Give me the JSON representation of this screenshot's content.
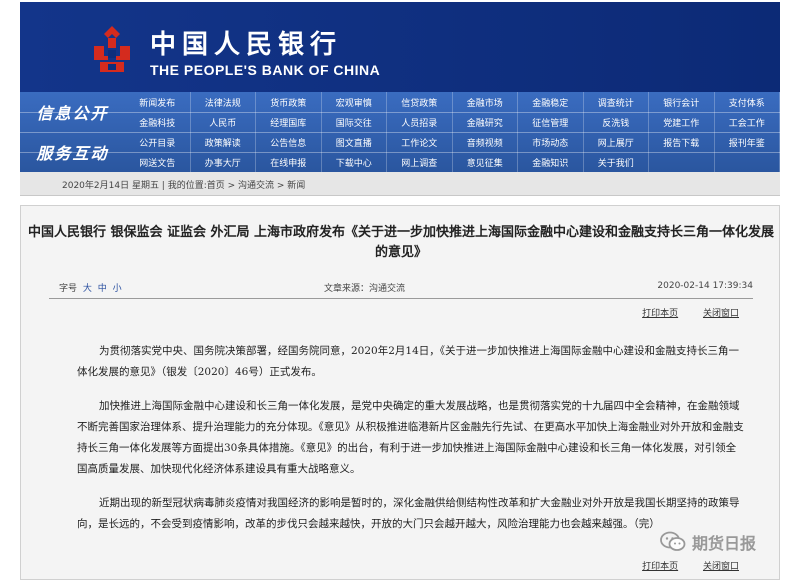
{
  "header": {
    "bank_name_cn": "中国人民银行",
    "bank_name_en": "THE PEOPLE'S BANK OF CHINA"
  },
  "nav": {
    "info_label": "信息公开",
    "service_label": "服务互动",
    "rows": [
      [
        "新闻发布",
        "法律法规",
        "货币政策",
        "宏观审慎",
        "信贷政策",
        "金融市场",
        "金融稳定",
        "调查统计",
        "银行会计",
        "支付体系"
      ],
      [
        "金融科技",
        "人民币",
        "经理国库",
        "国际交往",
        "人员招录",
        "金融研究",
        "征信管理",
        "反洗钱",
        "党建工作",
        "工会工作"
      ],
      [
        "公开目录",
        "政策解读",
        "公告信息",
        "图文直播",
        "工作论文",
        "音频视频",
        "市场动态",
        "网上展厅",
        "报告下载",
        "报刊年鉴"
      ],
      [
        "网送文告",
        "办事大厅",
        "在线申报",
        "下载中心",
        "网上调查",
        "意见征集",
        "金融知识",
        "关于我们",
        "",
        ""
      ]
    ]
  },
  "breadcrumb": "2020年2月14日 星期五 | 我的位置:首页 > 沟通交流 > 新闻",
  "article": {
    "title": "中国人民银行 银保监会 证监会 外汇局 上海市政府发布《关于进一步加快推进上海国际金融中心建设和金融支持长三角一体化发展的意见》",
    "font_label": "字号",
    "font_sizes": [
      "大",
      "中",
      "小"
    ],
    "source": "文章来源：沟通交流",
    "datetime": "2020-02-14 17:39:34",
    "print_label": "打印本页",
    "close_label": "关闭窗口",
    "paragraphs": [
      "为贯彻落实党中央、国务院决策部署，经国务院同意，2020年2月14日，《关于进一步加快推进上海国际金融中心建设和金融支持长三角一体化发展的意见》（银发〔2020〕46号）正式发布。",
      "加快推进上海国际金融中心建设和长三角一体化发展，是党中央确定的重大发展战略，也是贯彻落实党的十九届四中全会精神，在金融领域不断完善国家治理体系、提升治理能力的充分体现。《意见》从积极推进临港新片区金融先行先试、在更高水平加快上海金融业对外开放和金融支持长三角一体化发展等方面提出30条具体措施。《意见》的出台，有利于进一步加快推进上海国际金融中心建设和长三角一体化发展，对引领全国高质量发展、加快现代化经济体系建设具有重大战略意义。",
      "近期出现的新型冠状病毒肺炎疫情对我国经济的影响是暂时的，深化金融供给侧结构性改革和扩大金融业对外开放是我国长期坚持的政策导向，是长远的，不会受到疫情影响，改革的步伐只会越来越快，开放的大门只会越开越大，风险治理能力也会越来越强。（完）"
    ]
  },
  "watermark": "期货日报",
  "colors": {
    "header_bg": "#0d2e7c",
    "nav_bg": "#2f5fb0",
    "logo_red": "#d42b1e"
  }
}
